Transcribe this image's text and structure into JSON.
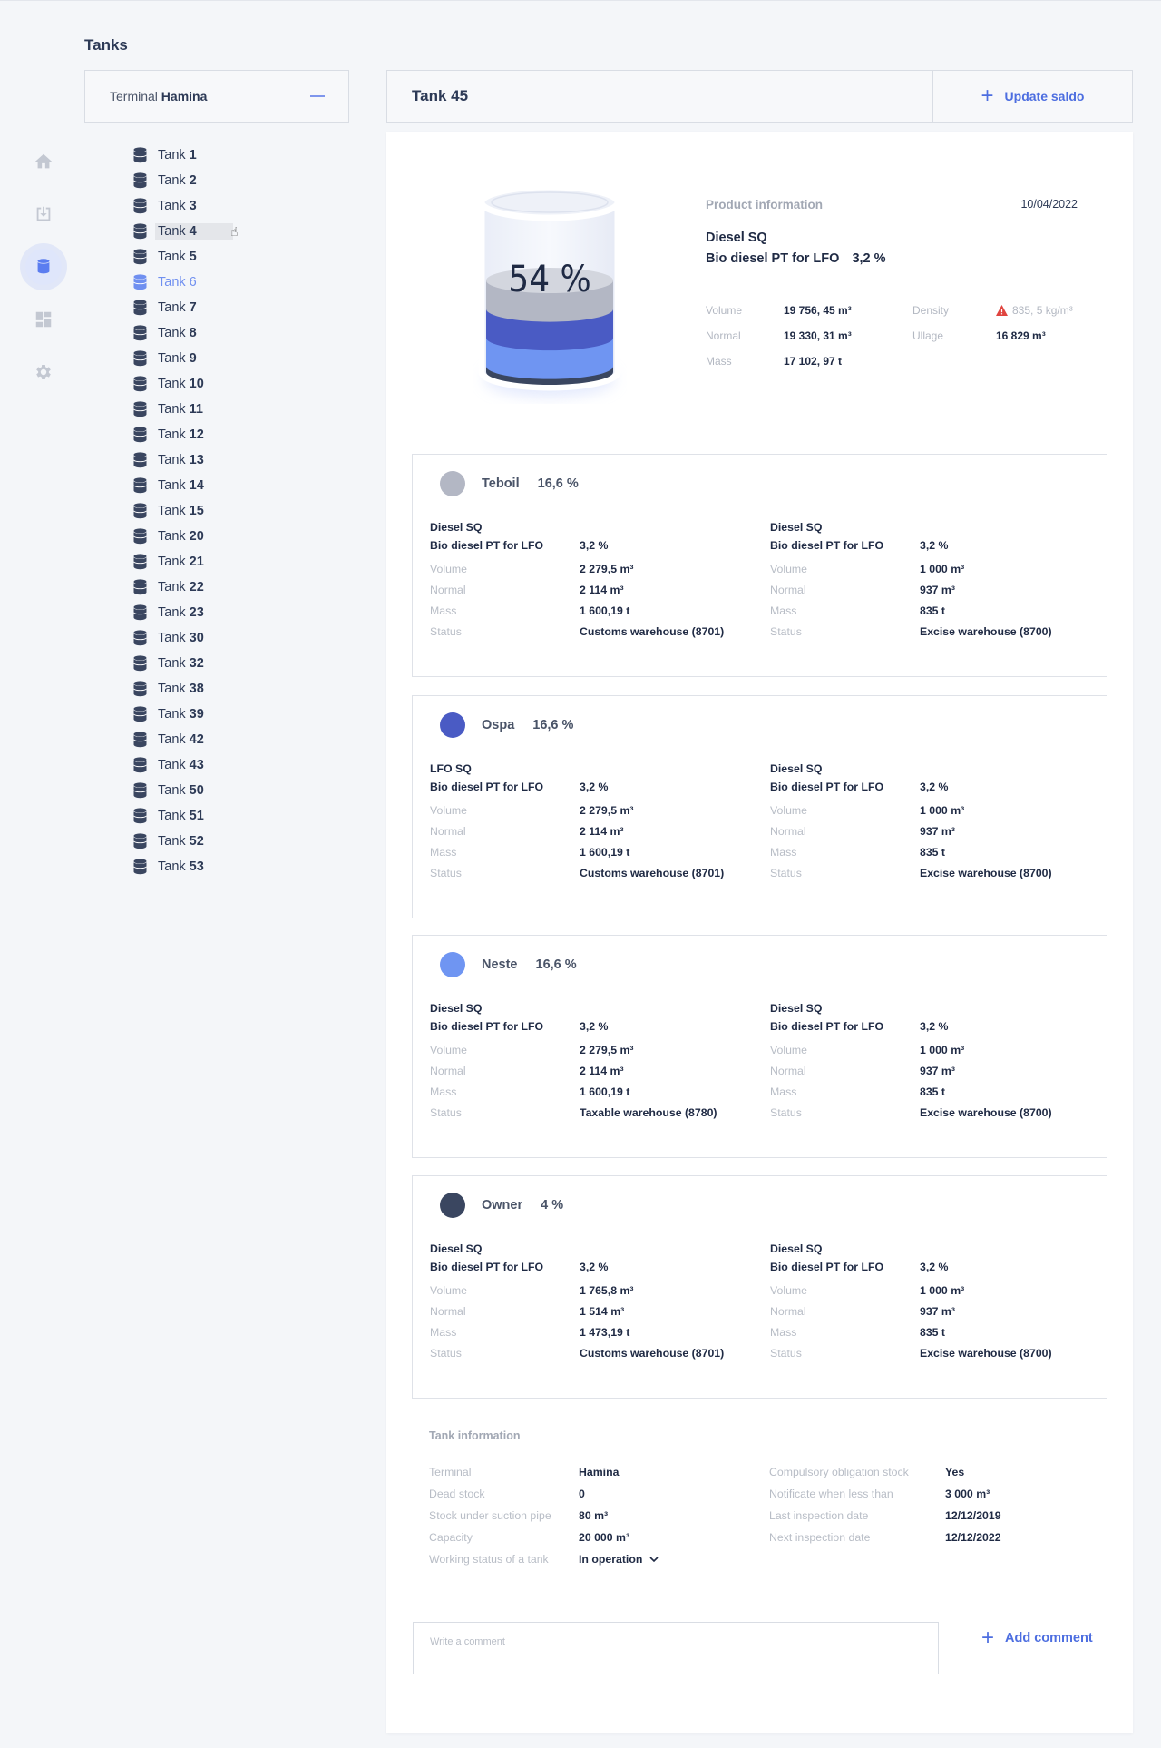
{
  "page": {
    "heading": "Tanks"
  },
  "nav": {
    "items": [
      "home-icon",
      "download-icon",
      "tank-icon",
      "dashboard-icon",
      "settings-icon"
    ],
    "active": "tank-icon"
  },
  "terminal": {
    "prefix": "Terminal",
    "name": "Hamina"
  },
  "tank_list": {
    "prefix": "Tank",
    "numbers": [
      "1",
      "2",
      "3",
      "4",
      "5",
      "6",
      "7",
      "8",
      "9",
      "10",
      "11",
      "12",
      "13",
      "14",
      "15",
      "20",
      "21",
      "22",
      "23",
      "30",
      "32",
      "38",
      "39",
      "42",
      "43",
      "50",
      "51",
      "52",
      "53"
    ],
    "active": "6",
    "hover": "4"
  },
  "header": {
    "title": "Tank 45",
    "update_label": "Update saldo"
  },
  "tank_fill": {
    "label": "54 %",
    "fill_fraction": 0.54
  },
  "product": {
    "label": "Product information",
    "date": "10/04/2022",
    "name_1": "Diesel SQ",
    "name_2": "Bio diesel PT for LFO",
    "pct": "3,2 %",
    "volume_k": "Volume",
    "volume_v": "19 756, 45  m³",
    "density_k": "Density",
    "density_v": "835, 5 kg/m³",
    "normal_k": "Normal",
    "normal_v": "19 330, 31  m³",
    "ullage_k": "Ullage",
    "ullage_v": "16 829 m³",
    "mass_k": "Mass",
    "mass_v": "17 102, 97  t"
  },
  "owners": [
    {
      "name": "Teboil",
      "pct": "16,6 %",
      "color": "#b3b7c4",
      "left": {
        "p1": "Diesel SQ",
        "p2": "Bio diesel PT for LFO",
        "pp": "3,2 %",
        "volume": "2 279,5  m³",
        "normal": "2 114  m³",
        "mass": "1 600,19  t",
        "status": "Customs warehouse (8701)"
      },
      "right": {
        "p1": "Diesel SQ",
        "p2": "Bio diesel PT for LFO",
        "pp": "3,2 %",
        "volume": "1 000  m³",
        "normal": "937  m³",
        "mass": "835  t",
        "status": "Excise warehouse (8700)"
      }
    },
    {
      "name": "Ospa",
      "pct": "16,6 %",
      "color": "#4a5bc4",
      "left": {
        "p1": "LFO SQ",
        "p2": "Bio diesel PT for LFO",
        "pp": "3,2 %",
        "volume": "2 279,5  m³",
        "normal": "2 114  m³",
        "mass": "1 600,19  t",
        "status": "Customs warehouse (8701)"
      },
      "right": {
        "p1": "Diesel SQ",
        "p2": "Bio diesel PT for LFO",
        "pp": "3,2 %",
        "volume": "1 000  m³",
        "normal": "937  m³",
        "mass": "835  t",
        "status": "Excise warehouse (8700)"
      }
    },
    {
      "name": "Neste",
      "pct": "16,6 %",
      "color": "#6f95f2",
      "left": {
        "p1": "Diesel SQ",
        "p2": "Bio diesel PT for LFO",
        "pp": "3,2 %",
        "volume": "2 279,5  m³",
        "normal": "2 114  m³",
        "mass": "1 600,19  t",
        "status": "Taxable warehouse (8780)"
      },
      "right": {
        "p1": "Diesel SQ",
        "p2": "Bio diesel PT for LFO",
        "pp": "3,2 %",
        "volume": "1 000  m³",
        "normal": "937  m³",
        "mass": "835  t",
        "status": "Excise warehouse (8700)"
      }
    },
    {
      "name": "Owner",
      "pct": "4 %",
      "color": "#3a4660",
      "left": {
        "p1": "Diesel SQ",
        "p2": "Bio diesel PT for LFO",
        "pp": "3,2 %",
        "volume": "1 765,8  m³",
        "normal": "1 514  m³",
        "mass": "1 473,19  t",
        "status": "Customs warehouse (8701)"
      },
      "right": {
        "p1": "Diesel SQ",
        "p2": "Bio diesel PT for LFO",
        "pp": "3,2 %",
        "volume": "1 000  m³",
        "normal": "937  m³",
        "mass": "835  t",
        "status": "Excise warehouse (8700)"
      }
    }
  ],
  "owner_labels": {
    "volume": "Volume",
    "normal": "Normal",
    "mass": "Mass",
    "status": "Status"
  },
  "tank_info": {
    "title": "Tank information",
    "left": [
      {
        "k": "Terminal",
        "v": "Hamina"
      },
      {
        "k": "Dead stock",
        "v": "0"
      },
      {
        "k": "Stock under suction pipe",
        "v": "80 m³"
      },
      {
        "k": "Capacity",
        "v": "20 000 m³"
      },
      {
        "k": "Working status of a tank",
        "v": "In operation"
      }
    ],
    "right": [
      {
        "k": "Compulsory obligation stock",
        "v": "Yes"
      },
      {
        "k": "Notificate when less than",
        "v": "3 000 m³"
      },
      {
        "k": "Last inspection date",
        "v": "12/12/2019"
      },
      {
        "k": "Next inspection date",
        "v": "12/12/2022"
      }
    ]
  },
  "comment": {
    "placeholder": "Write a comment",
    "add_label": "Add comment"
  }
}
